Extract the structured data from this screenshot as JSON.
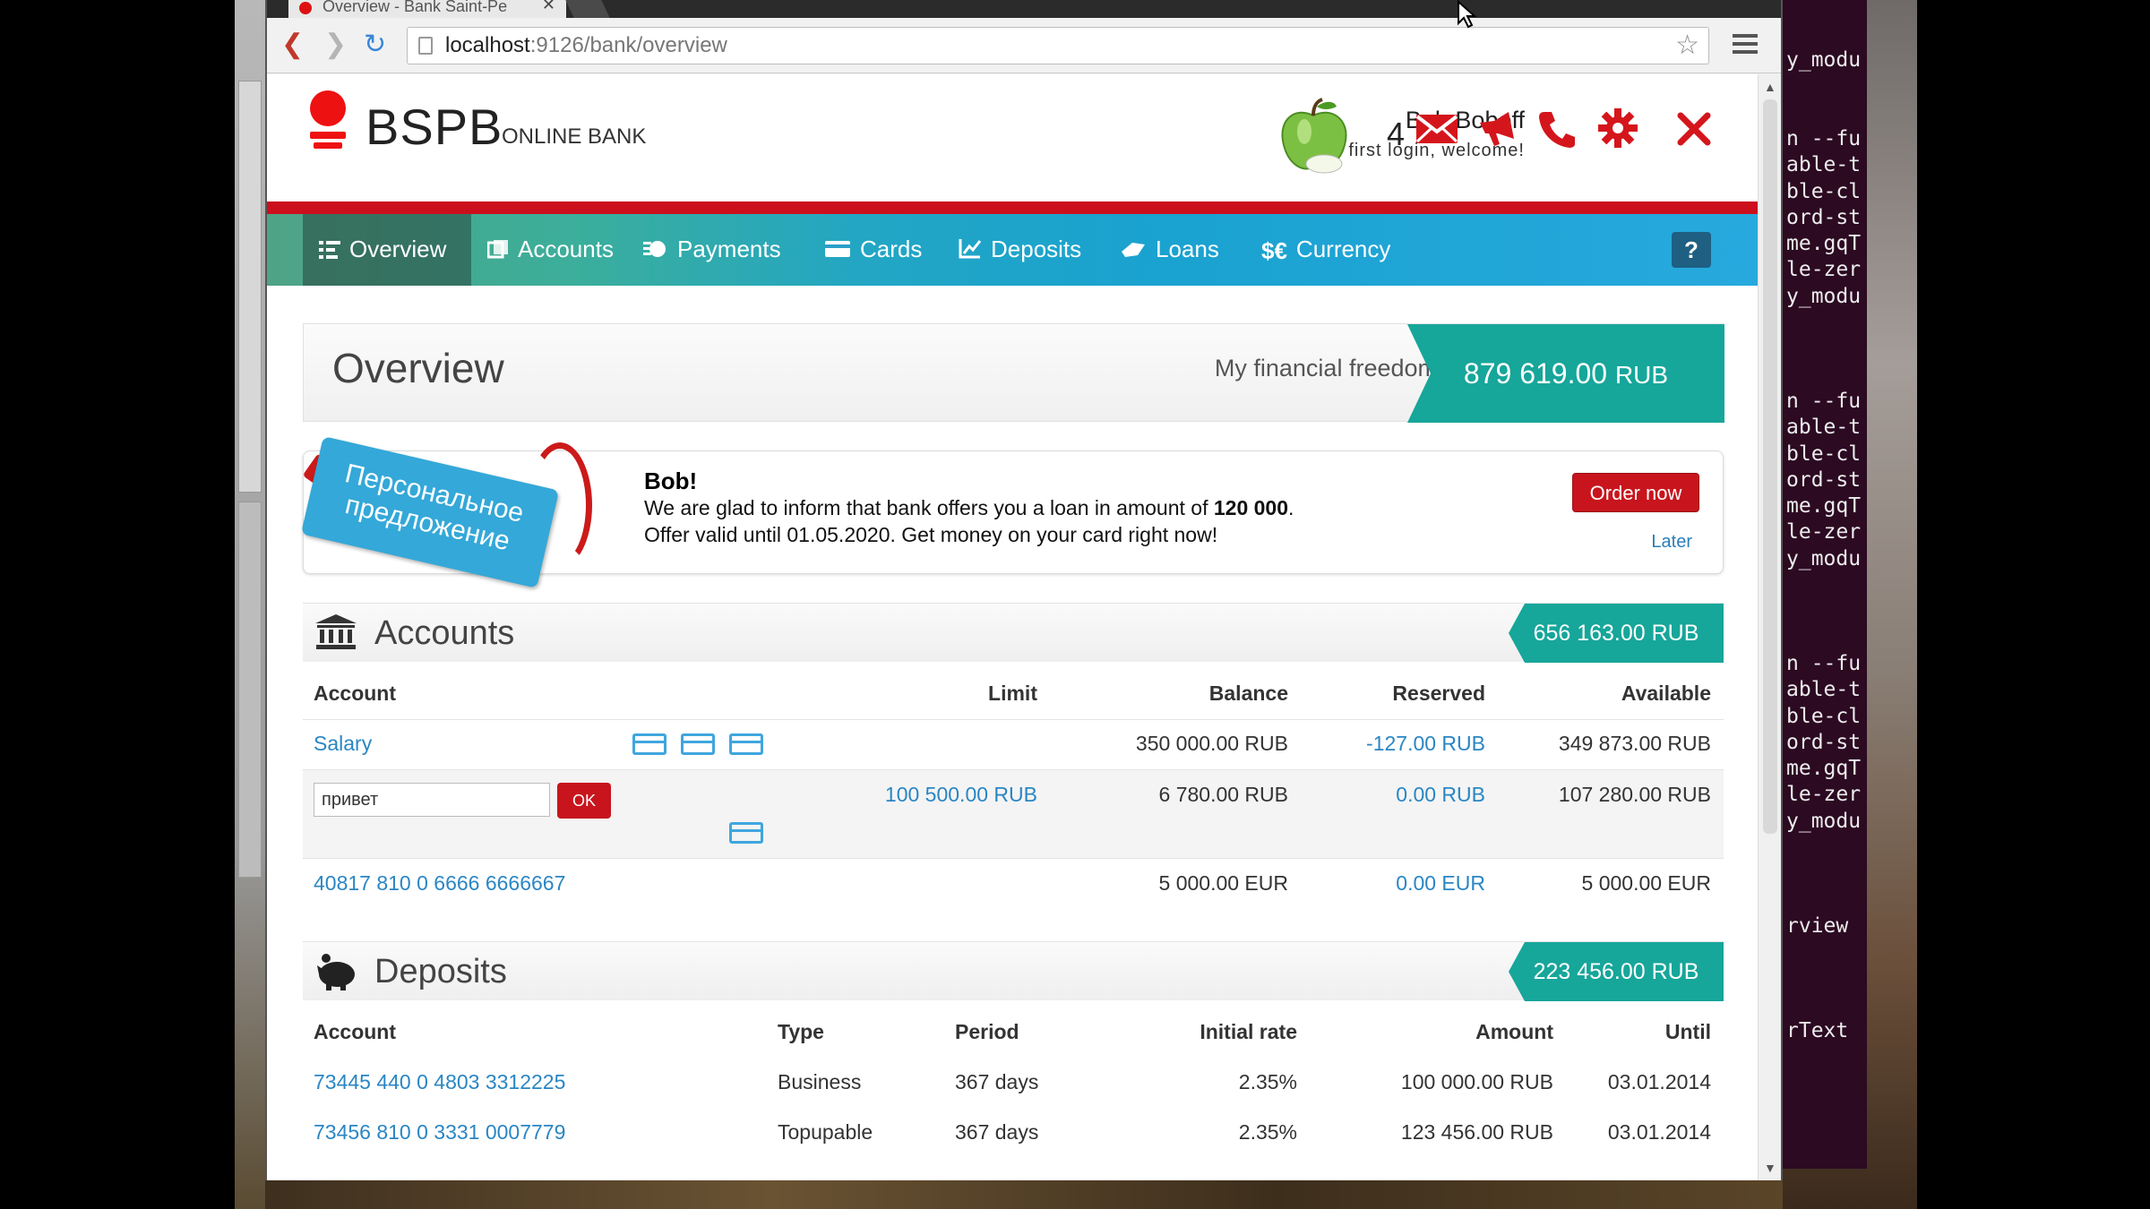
{
  "browser": {
    "tab_title": "Overview - Bank Saint-Pe",
    "url_host": "localhost",
    "url_rest": ":9126/bank/overview"
  },
  "terminal": {
    "lines": [
      "y_modu",
      "",
      "",
      "n --fu",
      "able-t",
      "ble-cl",
      "ord-st",
      "me.gqT",
      "le-zer",
      "y_modu",
      "",
      "",
      "",
      "n --fu",
      "able-t",
      "ble-cl",
      "ord-st",
      "me.gqT",
      "le-zer",
      "y_modu",
      "",
      "",
      "",
      "n --fu",
      "able-t",
      "ble-cl",
      "ord-st",
      "me.gqT",
      "le-zer",
      "y_modu",
      "",
      "",
      "",
      "rview",
      "",
      "",
      "",
      "rText"
    ]
  },
  "header": {
    "logo": "BSPB",
    "logo_sub": "ONLINE BANK",
    "user_name": "Bob Boboff",
    "welcome": "Your first login, welcome!",
    "message_count": "4"
  },
  "nav": {
    "items": [
      {
        "label": "Overview",
        "icon": "overview-icon"
      },
      {
        "label": "Accounts",
        "icon": "accounts-icon"
      },
      {
        "label": "Payments",
        "icon": "payments-icon"
      },
      {
        "label": "Cards",
        "icon": "cards-icon"
      },
      {
        "label": "Deposits",
        "icon": "deposits-icon"
      },
      {
        "label": "Loans",
        "icon": "loans-icon"
      },
      {
        "label": "Currency",
        "icon": "currency-icon"
      }
    ],
    "currency_symbol": "$€",
    "help": "?"
  },
  "overview": {
    "title": "Overview",
    "freedom_label": "My financial freedom",
    "total": "879 619.00",
    "total_currency": "RUB"
  },
  "offer": {
    "tag": "Персональное предложение",
    "name": "Bob!",
    "line1_prefix": "We are glad to inform that bank offers you a loan in amount of ",
    "line1_amount": "120 000",
    "line1_suffix": ".",
    "line2": "Offer valid until 01.05.2020. Get money on your card right now!",
    "order_button": "Order now",
    "later": "Later"
  },
  "accounts": {
    "title": "Accounts",
    "total": "656 163.00 RUB",
    "columns": [
      "Account",
      "Limit",
      "Balance",
      "Reserved",
      "Available"
    ],
    "rows": [
      {
        "account": "Salary",
        "limit": "",
        "balance": "350 000.00 RUB",
        "reserved": "-127.00 RUB",
        "available": "349 873.00 RUB"
      },
      {
        "account": "привет",
        "limit": "100 500.00 RUB",
        "balance": "6 780.00 RUB",
        "reserved": "0.00 RUB",
        "available": "107 280.00 RUB"
      },
      {
        "account": "40817 810 0 6666 6666667",
        "limit": "",
        "balance": "5 000.00 EUR",
        "reserved": "0.00 EUR",
        "available": "5 000.00 EUR"
      }
    ],
    "ok_label": "OK"
  },
  "deposits": {
    "title": "Deposits",
    "total": "223 456.00 RUB",
    "columns": [
      "Account",
      "Type",
      "Period",
      "Initial rate",
      "Amount",
      "Until"
    ],
    "rows": [
      {
        "account": "73445 440 0 4803 3312225",
        "type": "Business",
        "period": "367 days",
        "rate": "2.35%",
        "amount": "100 000.00 RUB",
        "until": "03.01.2014"
      },
      {
        "account": "73456 810 0 3331 0007779",
        "type": "Topupable",
        "period": "367 days",
        "rate": "2.35%",
        "amount": "123 456.00 RUB",
        "until": "03.01.2014"
      }
    ]
  },
  "colors": {
    "brand_red": "#cc0f1c",
    "teal": "#17a69a",
    "link_blue": "#2a86c4"
  }
}
